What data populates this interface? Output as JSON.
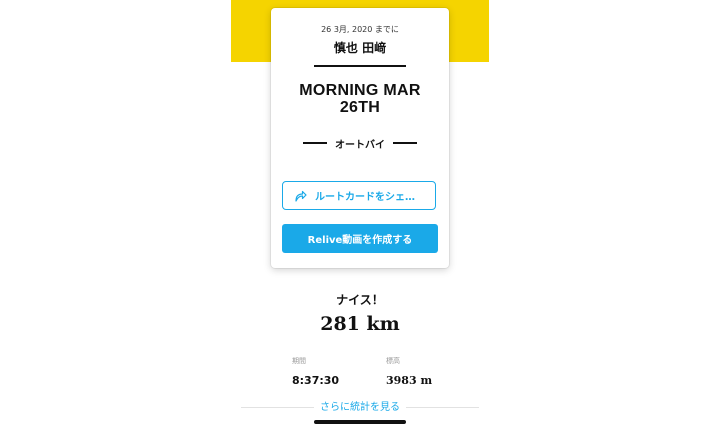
{
  "colors": {
    "accent_yellow": "#f5d400",
    "primary_blue": "#1aa9e8",
    "text_dark": "#111111",
    "muted_gray": "#999999"
  },
  "card": {
    "date": "26 3月, 2020 までに",
    "athlete_name": "慎也 田﨑",
    "title_line1": "MORNING MAR",
    "title_line2": "26TH",
    "activity_type": "オートバイ",
    "share_button_label": "ルートカードをシェ…",
    "share_icon": "share-arrow-icon",
    "create_button_label": "Relive動画を作成する"
  },
  "summary": {
    "praise": "ナイス！",
    "distance": "281 km",
    "duration_label": "期間",
    "duration_value": "8:37:30",
    "elevation_label": "標高",
    "elevation_value": "3983 m",
    "more_stats_link": "さらに統計を見る"
  }
}
